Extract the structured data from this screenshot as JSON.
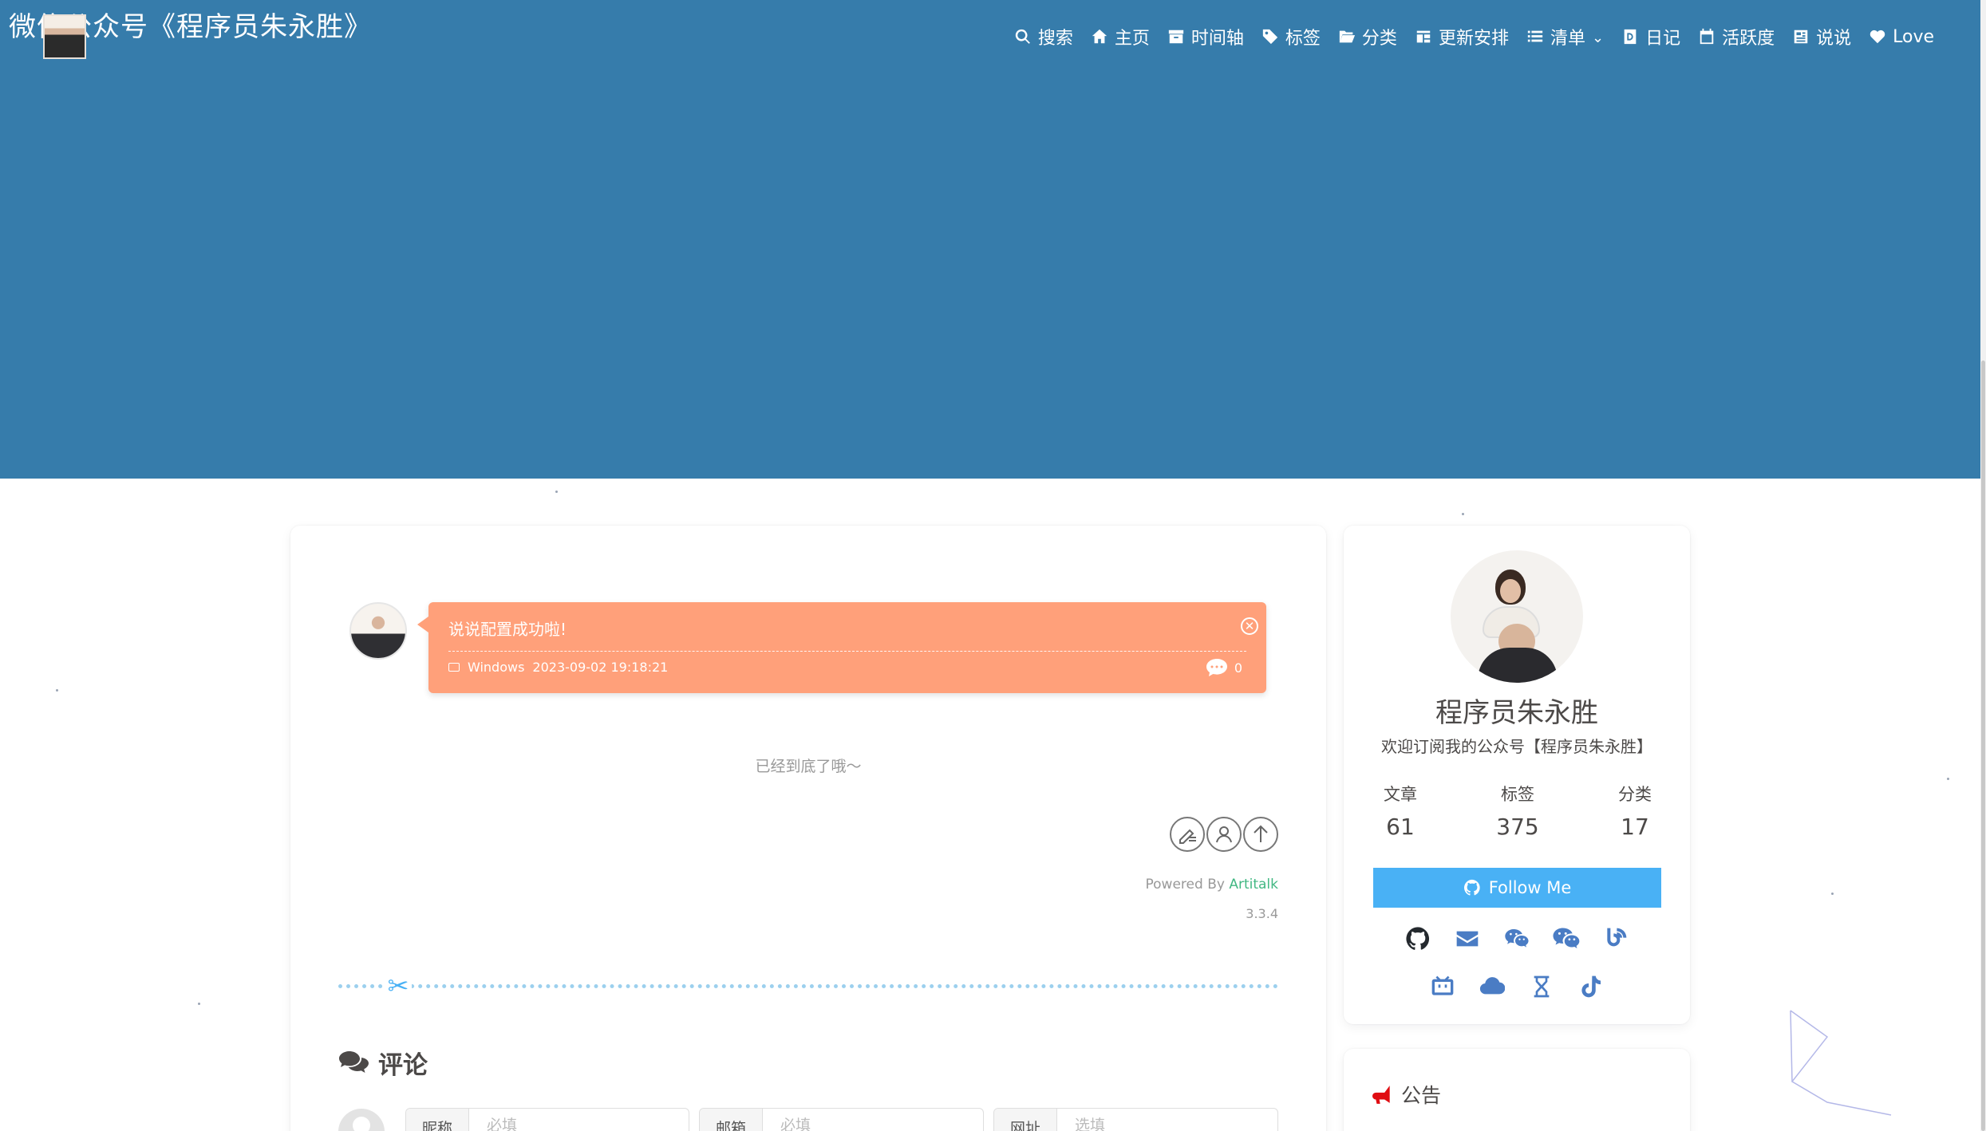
{
  "site": {
    "title": "微信公众号《程序员朱永胜》"
  },
  "nav": [
    {
      "label": "搜索",
      "icon": "search-icon"
    },
    {
      "label": "主页",
      "icon": "home-icon"
    },
    {
      "label": "时间轴",
      "icon": "archive-icon"
    },
    {
      "label": "标签",
      "icon": "tags-icon"
    },
    {
      "label": "分类",
      "icon": "folder-open-icon"
    },
    {
      "label": "更新安排",
      "icon": "schedule-icon"
    },
    {
      "label": "清单",
      "icon": "list-icon",
      "dropdown": true
    },
    {
      "label": "日记",
      "icon": "diary-icon"
    },
    {
      "label": "活跃度",
      "icon": "calendar-icon"
    },
    {
      "label": "说说",
      "icon": "newspaper-icon"
    },
    {
      "label": "Love",
      "icon": "heart-icon"
    }
  ],
  "talk": {
    "text": "说说配置成功啦!",
    "os": "Windows",
    "datetime": "2023-09-02 19:18:21",
    "comment_count": "0",
    "bubble_color": "#ffa07a"
  },
  "end_message": "已经到底了哦～",
  "powered": {
    "prefix": "Powered By ",
    "brand": "Artitalk",
    "version": "3.3.4",
    "brand_color": "#42b883"
  },
  "comments": {
    "title": "评论",
    "fields": [
      {
        "label": "昵称",
        "placeholder": "必填"
      },
      {
        "label": "邮箱",
        "placeholder": "必填"
      },
      {
        "label": "网址",
        "placeholder": "选填"
      }
    ]
  },
  "author": {
    "name": "程序员朱永胜",
    "description": "欢迎订阅我的公众号【程序员朱永胜】",
    "stats": [
      {
        "label": "文章",
        "value": "61"
      },
      {
        "label": "标签",
        "value": "375"
      },
      {
        "label": "分类",
        "value": "17"
      }
    ],
    "follow_label": "Follow Me",
    "social_row1": [
      "github-icon",
      "email-icon",
      "wechat-icon",
      "wechat-alt-icon",
      "blog-icon"
    ],
    "social_row2": [
      "bilibili-icon",
      "cloud-icon",
      "hourglass-icon",
      "tiktok-icon"
    ]
  },
  "notice": {
    "title": "公告"
  },
  "colors": {
    "header_bg": "#367cab",
    "accent": "#49b1f5",
    "notice_icon": "#e00d12"
  }
}
